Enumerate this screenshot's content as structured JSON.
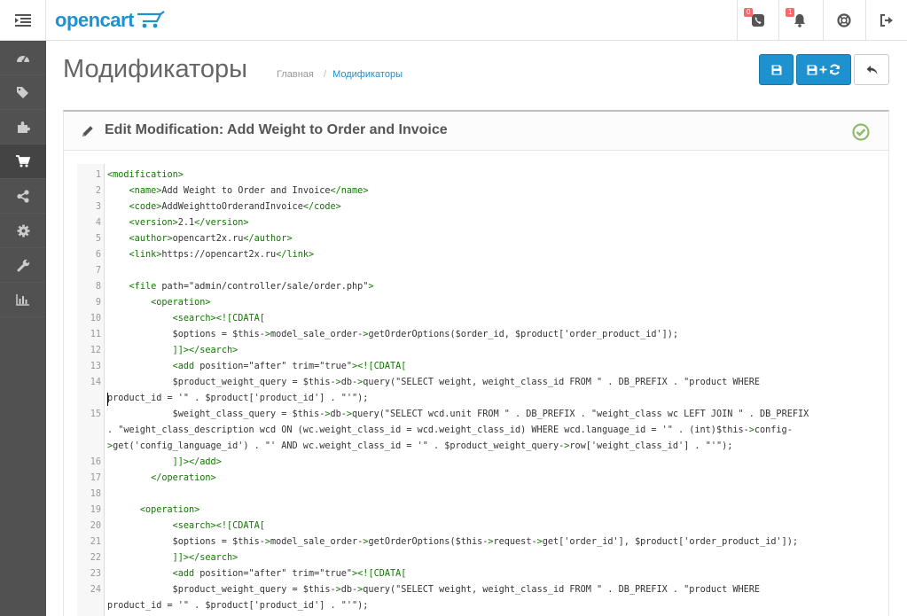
{
  "header": {
    "logo_text": "opencart",
    "notifications": [
      {
        "icon": "phone-icon",
        "count": "0"
      },
      {
        "icon": "bell-icon",
        "count": "1"
      }
    ]
  },
  "sidebar": {
    "items": [
      {
        "icon": "dashboard-icon"
      },
      {
        "icon": "tags-icon"
      },
      {
        "icon": "puzzle-icon"
      },
      {
        "icon": "shopping-cart-icon"
      },
      {
        "icon": "share-icon"
      },
      {
        "icon": "gear-icon"
      },
      {
        "icon": "wrench-icon"
      },
      {
        "icon": "bar-chart-icon"
      }
    ]
  },
  "page": {
    "title": "Модификаторы",
    "breadcrumb": {
      "home": "Главная",
      "separator": "/",
      "current": "Модификаторы"
    }
  },
  "panel": {
    "title": "Edit Modification: Add Weight to Order and Invoice"
  },
  "colors": {
    "brand": "#1e91cf",
    "sidebar": "#515151",
    "tag": "#117700",
    "success": "#8fbb6c",
    "badge": "#f56b6b"
  },
  "code_lines": [
    {
      "n": "1",
      "text": "<modification>"
    },
    {
      "n": "2",
      "text": "    <name>Add Weight to Order and Invoice</name>"
    },
    {
      "n": "3",
      "text": "    <code>AddWeighttoOrderandInvoice</code>"
    },
    {
      "n": "4",
      "text": "    <version>2.1</version>"
    },
    {
      "n": "5",
      "text": "    <author>opencart2x.ru</author>"
    },
    {
      "n": "6",
      "text": "    <link>https://opencart2x.ru</link>"
    },
    {
      "n": "7",
      "text": ""
    },
    {
      "n": "8",
      "text": "    <file path=\"admin/controller/sale/order.php\">"
    },
    {
      "n": "9",
      "text": "        <operation>"
    },
    {
      "n": "10",
      "text": "            <search><![CDATA["
    },
    {
      "n": "11",
      "text": "            $options = $this->model_sale_order->getOrderOptions($order_id, $product['order_product_id']);"
    },
    {
      "n": "12",
      "text": "            ]]></search>"
    },
    {
      "n": "13",
      "text": "            <add position=\"after\" trim=\"true\"><![CDATA["
    },
    {
      "n": "14",
      "text": "            $product_weight_query = $this->db->query(\"SELECT weight, weight_class_id FROM \" . DB_PREFIX . \"product WHERE"
    },
    {
      "n": "",
      "text": "product_id = '\" . $product['product_id'] . \"'\");"
    },
    {
      "n": "15",
      "text": "            $weight_class_query = $this->db->query(\"SELECT wcd.unit FROM \" . DB_PREFIX . \"weight_class wc LEFT JOIN \" . DB_PREFIX"
    },
    {
      "n": "",
      "text": ". \"weight_class_description wcd ON (wc.weight_class_id = wcd.weight_class_id) WHERE wcd.language_id = '\" . (int)$this->config-"
    },
    {
      "n": "",
      "text": ">get('config_language_id') . \"' AND wc.weight_class_id = '\" . $product_weight_query->row['weight_class_id'] . \"'\");"
    },
    {
      "n": "16",
      "text": "            ]]></add>"
    },
    {
      "n": "17",
      "text": "        </operation>"
    },
    {
      "n": "18",
      "text": ""
    },
    {
      "n": "19",
      "text": "      <operation>"
    },
    {
      "n": "20",
      "text": "            <search><![CDATA["
    },
    {
      "n": "21",
      "text": "            $options = $this->model_sale_order->getOrderOptions($this->request->get['order_id'], $product['order_product_id']);"
    },
    {
      "n": "22",
      "text": "            ]]></search>"
    },
    {
      "n": "23",
      "text": "            <add position=\"after\" trim=\"true\"><![CDATA["
    },
    {
      "n": "24",
      "text": "            $product_weight_query = $this->db->query(\"SELECT weight, weight_class_id FROM \" . DB_PREFIX . \"product WHERE"
    },
    {
      "n": "",
      "text": "product_id = '\" . $product['product_id'] . \"'\");"
    }
  ]
}
